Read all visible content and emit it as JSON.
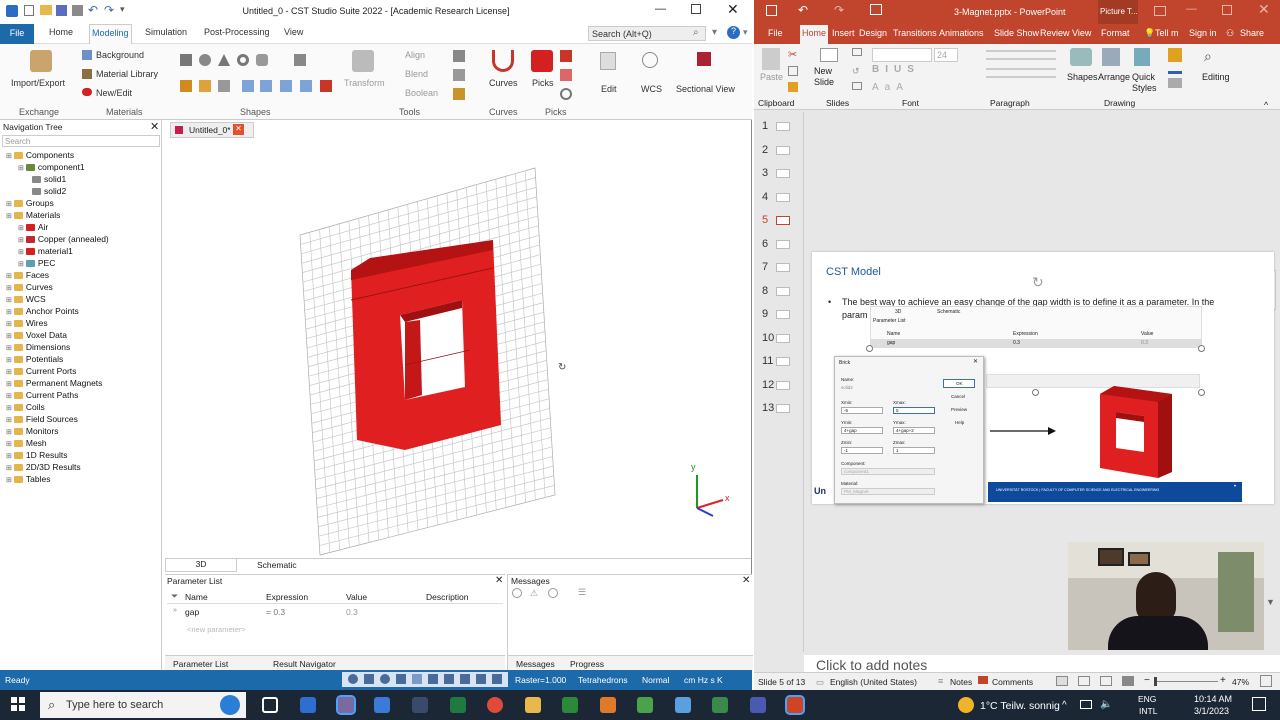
{
  "cst": {
    "title": "Untitled_0 - CST Studio Suite 2022 - [Academic Research License]",
    "tabs": [
      "File",
      "Home",
      "Modeling",
      "Simulation",
      "Post-Processing",
      "View"
    ],
    "search_placeholder": "Search (Alt+Q)",
    "ribbon": {
      "import_export": "Import/Export",
      "background": "Background",
      "material_library": "Material Library",
      "new_edit": "New/Edit",
      "align": "Align",
      "blend": "Blend",
      "boolean": "Boolean",
      "transform": "Transform",
      "curves": "Curves",
      "picks": "Picks",
      "edit": "Edit",
      "wcs": "WCS",
      "sectional_view": "Sectional View",
      "groups": [
        "Exchange",
        "Materials",
        "Shapes",
        "Tools",
        "Curves",
        "Picks"
      ]
    },
    "nav": {
      "title": "Navigation Tree",
      "search_placeholder": "Search",
      "items": [
        {
          "label": "Components",
          "depth": 0
        },
        {
          "label": "component1",
          "depth": 1
        },
        {
          "label": "solid1",
          "depth": 2
        },
        {
          "label": "solid2",
          "depth": 2
        },
        {
          "label": "Groups",
          "depth": 0
        },
        {
          "label": "Materials",
          "depth": 0
        },
        {
          "label": "Air",
          "depth": 1
        },
        {
          "label": "Copper (annealed)",
          "depth": 1
        },
        {
          "label": "material1",
          "depth": 1
        },
        {
          "label": "PEC",
          "depth": 1
        },
        {
          "label": "Faces",
          "depth": 0
        },
        {
          "label": "Curves",
          "depth": 0
        },
        {
          "label": "WCS",
          "depth": 0
        },
        {
          "label": "Anchor Points",
          "depth": 0
        },
        {
          "label": "Wires",
          "depth": 0
        },
        {
          "label": "Voxel Data",
          "depth": 0
        },
        {
          "label": "Dimensions",
          "depth": 0
        },
        {
          "label": "Potentials",
          "depth": 0
        },
        {
          "label": "Current Ports",
          "depth": 0
        },
        {
          "label": "Permanent Magnets",
          "depth": 0
        },
        {
          "label": "Current Paths",
          "depth": 0
        },
        {
          "label": "Coils",
          "depth": 0
        },
        {
          "label": "Field Sources",
          "depth": 0
        },
        {
          "label": "Monitors",
          "depth": 0
        },
        {
          "label": "Mesh",
          "depth": 0
        },
        {
          "label": "1D Results",
          "depth": 0
        },
        {
          "label": "2D/3D Results",
          "depth": 0
        },
        {
          "label": "Tables",
          "depth": 0
        }
      ]
    },
    "doc_tab": "Untitled_0*",
    "view_tabs": [
      "3D",
      "Schematic"
    ],
    "axis": {
      "y": "y",
      "x": "x"
    },
    "params": {
      "title": "Parameter List",
      "headers": [
        "Name",
        "Expression",
        "Value",
        "Description"
      ],
      "row": {
        "name": "gap",
        "expression": "= 0.3",
        "value": "0.3"
      },
      "new_param": "<new parameter>",
      "tabs": [
        "Parameter List",
        "Result Navigator"
      ]
    },
    "messages": {
      "title": "Messages",
      "tabs": [
        "Messages",
        "Progress"
      ]
    },
    "status": {
      "ready": "Ready",
      "raster": "Raster=1.000",
      "mesh": "Tetrahedrons",
      "mode": "Normal",
      "units": "cm  Hz  s  K"
    }
  },
  "ppt": {
    "title": "3-Magnet.pptx - PowerPoint",
    "picture_tools": "Picture T...",
    "sign_in": "Sign in",
    "share": "Share",
    "tabs": [
      "File",
      "Home",
      "Insert",
      "Design",
      "Transitions",
      "Animations",
      "Slide Show",
      "Review",
      "View",
      "Format"
    ],
    "tell_me": "Tell m",
    "ribbon": {
      "paste": "Paste",
      "new_slide": "New Slide",
      "shapes": "Shapes",
      "arrange": "Arrange",
      "quick_styles": "Quick Styles",
      "editing": "Editing",
      "font_size": "24",
      "groups": [
        "Clipboard",
        "Slides",
        "Font",
        "Paragraph",
        "Drawing"
      ]
    },
    "slide_numbers": [
      "1",
      "2",
      "3",
      "4",
      "5",
      "6",
      "7",
      "8",
      "9",
      "10",
      "11",
      "12",
      "13"
    ],
    "active_slide": 4,
    "slide": {
      "title": "CST Model",
      "bullet": "The best way to achieve an easy change of the gap width is to define it as a parameter. In the",
      "bullet2": "param",
      "embed_tabs": [
        "3D",
        "Schematic"
      ],
      "embed_param_title": "Parameter List",
      "embed_headers": [
        "Name",
        "Expression",
        "Value"
      ],
      "embed_row": {
        "name": "gap",
        "expression": "0.3",
        "value": "0.3"
      },
      "dialog": {
        "title": "Brick",
        "name_label": "Name:",
        "name_value": "solid2",
        "xmin_label": "Xmin:",
        "xmin_value": "-5",
        "xmax_label": "Xmax:",
        "xmax_value": "5",
        "ymin_label": "Ymin:",
        "ymin_value": "4+gap",
        "ymax_label": "Ymax:",
        "ymax_value": "4+gap+2",
        "zmin_label": "Zmin:",
        "zmin_value": "-1",
        "zmax_label": "Zmax:",
        "zmax_value": "1",
        "component_label": "Component:",
        "component_value": "component1",
        "material_label": "Material:",
        "material_value": "PM_Magnet",
        "buttons": [
          "OK",
          "Cancel",
          "Preview",
          "Help"
        ]
      },
      "footer_left": "Un",
      "banner": "UNIVERSITÄT ROSTOCK  |  FACULTY OF COMPUTER SCIENCE AND ELECTRICAL ENGINEERING"
    },
    "notes_placeholder": "Click to add notes",
    "status": {
      "slide": "Slide 5 of 13",
      "language": "English (United States)",
      "notes": "Notes",
      "comments": "Comments",
      "zoom": "47%"
    }
  },
  "taskbar": {
    "search": "Type here to search",
    "weather": "1°C  Teilw. sonnig",
    "lang": "ENG",
    "lang2": "INTL",
    "time": "10:14 AM",
    "date": "3/1/2023"
  }
}
